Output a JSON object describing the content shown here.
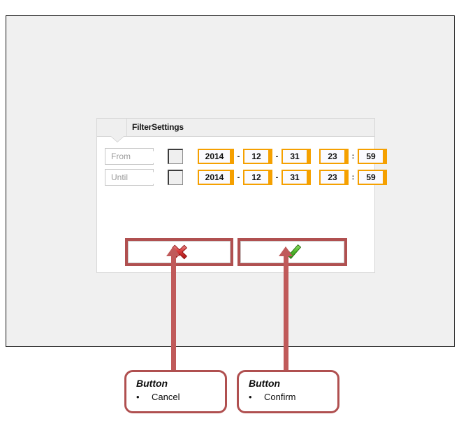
{
  "dialog": {
    "title": "FilterSettings",
    "rows": [
      {
        "label": "From",
        "checkbox": "checkbox-unchecked",
        "year": "2014",
        "sep1": "-",
        "month": "12",
        "sep2": "-",
        "day": "31",
        "hour": "23",
        "sep3": ":",
        "minute": "59"
      },
      {
        "label": "Until",
        "checkbox": "checkbox-unchecked",
        "year": "2014",
        "sep1": "-",
        "month": "12",
        "sep2": "-",
        "day": "31",
        "hour": "23",
        "sep3": ":",
        "minute": "59"
      }
    ],
    "buttons": [
      {
        "name": "cancel",
        "icon": "red-cross-icon"
      },
      {
        "name": "confirm",
        "icon": "green-check-icon"
      }
    ]
  },
  "callouts": [
    {
      "title": "Button",
      "item": "Cancel"
    },
    {
      "title": "Button",
      "item": "Confirm"
    }
  ],
  "bullet": "•",
  "colors": {
    "canvas_background": "#f0f0f0",
    "canvas_border": "#111111",
    "dialog_background": "#ffffff",
    "dialog_header": "#efefef",
    "field_accent": "#f5a000",
    "highlight_red": "#b05050",
    "arrow_red": "#c05a5a",
    "cross_red": "#cc2020",
    "check_green": "#4caf2a",
    "label_text": "#9a9a9a"
  }
}
